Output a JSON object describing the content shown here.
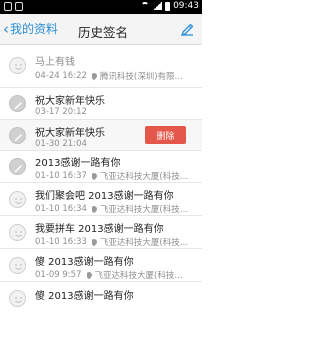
{
  "status_bar": {
    "time": "09:43"
  },
  "header": {
    "back_label": "我的资料",
    "title": "历史签名"
  },
  "items": [
    {
      "text": "马上有钱",
      "date": "04-24 16:22",
      "location": "腾讯科技(深圳)有限…",
      "style": "muted",
      "node": "smile"
    },
    {
      "text": "祝大家新年快乐",
      "date": "03-17 20:12",
      "location": "",
      "style": "normal",
      "node": "pencil"
    },
    {
      "text": "祝大家新年快乐",
      "date": "01-30 21:04",
      "location": "",
      "style": "normal",
      "node": "pencil",
      "delete_label": "删除"
    },
    {
      "text": "2013感谢一路有你",
      "date": "01-10 16:37",
      "location": "飞亚达科技大厦(科技…",
      "style": "normal",
      "node": "pencil"
    },
    {
      "text": "我们聚会吧 2013感谢一路有你",
      "date": "01-10 16:34",
      "location": "飞亚达科技大厦(科技…",
      "style": "normal",
      "node": "smile"
    },
    {
      "text": "我要拼车 2013感谢一路有你",
      "date": "01-10 16:33",
      "location": "飞亚达科技大厦(科技…",
      "style": "normal",
      "node": "smile"
    },
    {
      "text": "傻 2013感谢一路有你",
      "date": "01-09 9:57",
      "location": "飞亚达科技大厦(科技…",
      "style": "normal",
      "node": "smile"
    },
    {
      "text": "傻 2013感谢一路有你",
      "date": "",
      "location": "",
      "style": "normal",
      "node": "smile"
    }
  ]
}
